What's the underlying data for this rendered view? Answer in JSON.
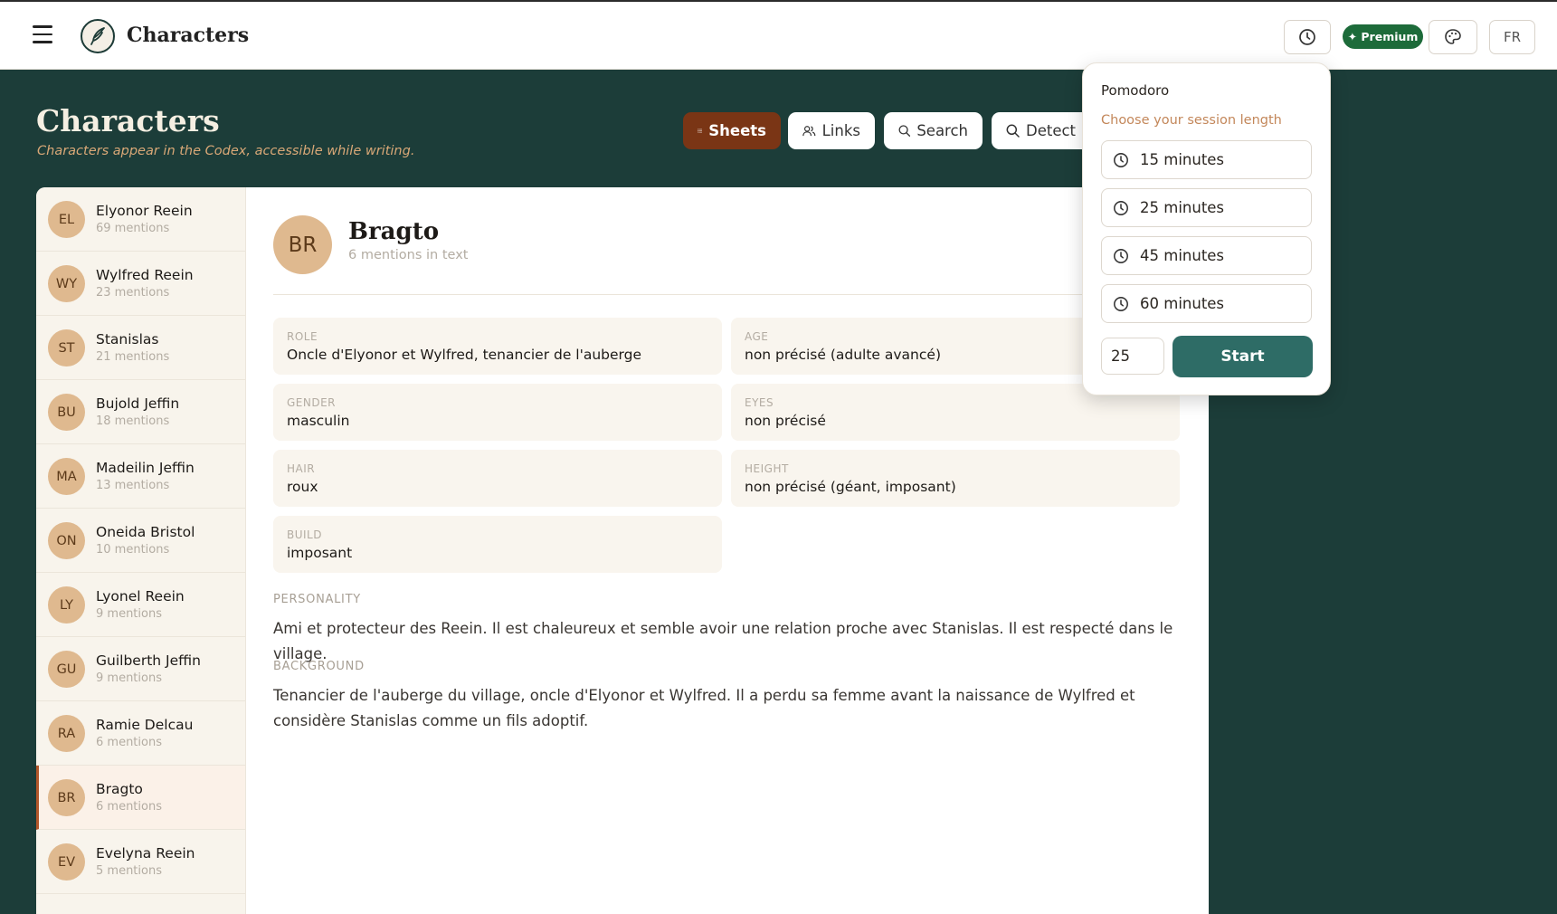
{
  "topbar": {
    "app_title": "Characters",
    "premium_label": "✦ Premium",
    "lang_label": "FR",
    "icons": [
      "menu-icon",
      "quill-logo",
      "clock-icon",
      "palette-icon"
    ]
  },
  "header": {
    "title": "Characters",
    "subtitle": "Characters appear in the Codex, accessible while writing.",
    "tabs": [
      {
        "label": "Sheets",
        "icon": "list-icon",
        "active": true
      },
      {
        "label": "Links",
        "icon": "users-icon",
        "active": false
      },
      {
        "label": "Search",
        "icon": "search-icon",
        "active": false
      },
      {
        "label": "Detect",
        "icon": "search-icon",
        "active": false
      }
    ]
  },
  "sidebar": {
    "items": [
      {
        "initials": "EL",
        "name": "Elyonor Reein",
        "mentions": "69 mentions"
      },
      {
        "initials": "WY",
        "name": "Wylfred Reein",
        "mentions": "23 mentions"
      },
      {
        "initials": "ST",
        "name": "Stanislas",
        "mentions": "21 mentions"
      },
      {
        "initials": "BU",
        "name": "Bujold Jeffin",
        "mentions": "18 mentions"
      },
      {
        "initials": "MA",
        "name": "Madeilin Jeffin",
        "mentions": "13 mentions"
      },
      {
        "initials": "ON",
        "name": "Oneida Bristol",
        "mentions": "10 mentions"
      },
      {
        "initials": "LY",
        "name": "Lyonel Reein",
        "mentions": "9 mentions"
      },
      {
        "initials": "GU",
        "name": "Guilberth Jeffin",
        "mentions": "9 mentions"
      },
      {
        "initials": "RA",
        "name": "Ramie Delcau",
        "mentions": "6 mentions"
      },
      {
        "initials": "BR",
        "name": "Bragto",
        "mentions": "6 mentions",
        "selected": true
      },
      {
        "initials": "EV",
        "name": "Evelyna Reein",
        "mentions": "5 mentions"
      }
    ]
  },
  "detail": {
    "initials": "BR",
    "name": "Bragto",
    "mentions": "6 mentions in text",
    "fields": {
      "role": {
        "label": "ROLE",
        "value": "Oncle d'Elyonor et Wylfred, tenancier de l'auberge"
      },
      "age": {
        "label": "AGE",
        "value": "non précisé (adulte avancé)"
      },
      "gender": {
        "label": "GENDER",
        "value": "masculin"
      },
      "eyes": {
        "label": "EYES",
        "value": "non précisé"
      },
      "hair": {
        "label": "HAIR",
        "value": "roux"
      },
      "height": {
        "label": "HEIGHT",
        "value": "non précisé (géant, imposant)"
      },
      "build": {
        "label": "BUILD",
        "value": "imposant"
      }
    },
    "personality": {
      "label": "PERSONALITY",
      "text": "Ami et protecteur des Reein. Il est chaleureux et semble avoir une relation proche avec Stanislas. Il est respecté dans le village."
    },
    "background": {
      "label": "BACKGROUND",
      "text": "Tenancier de l'auberge du village, oncle d'Elyonor et Wylfred. Il a perdu sa femme avant la naissance de Wylfred et considère Stanislas comme un fils adoptif."
    }
  },
  "pomodoro": {
    "title": "Pomodoro",
    "subtitle": "Choose your session length",
    "options": [
      "15 minutes",
      "25 minutes",
      "45 minutes",
      "60 minutes"
    ],
    "custom_value": "25",
    "start_label": "Start"
  },
  "colors": {
    "background": "#1c3d39",
    "accent": "#7a3515",
    "premium": "#1d6b3a",
    "start_button": "#2e6c66",
    "avatar": "#dfb98f"
  }
}
